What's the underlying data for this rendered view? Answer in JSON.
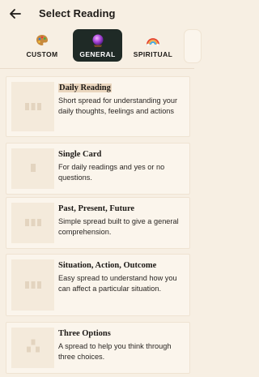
{
  "header": {
    "title": "Select Reading"
  },
  "tabs": [
    {
      "label": "CUSTOM",
      "icon": "palette-icon",
      "active": false
    },
    {
      "label": "GENERAL",
      "icon": "crystal-ball-icon",
      "active": true
    },
    {
      "label": "SPIRITUAL",
      "icon": "rainbow-icon",
      "active": false
    }
  ],
  "readings": [
    {
      "title": "Daily Reading",
      "description": "Short spread for understanding your daily thoughts, feelings and actions",
      "icon": "three-cards-icon"
    },
    {
      "title": "Single Card",
      "description": "For daily readings and yes or no questions.",
      "icon": "single-card-icon"
    },
    {
      "title": "Past, Present, Future",
      "description": "Simple spread built to give a general comprehension.",
      "icon": "three-cards-icon"
    },
    {
      "title": "Situation, Action, Outcome",
      "description": "Easy spread to understand how you can affect a particular situation.",
      "icon": "three-cards-icon"
    },
    {
      "title": "Three Options",
      "description": "A spread to help you think through three choices.",
      "icon": "pyramid-cards-icon"
    }
  ],
  "colors": {
    "background": "#f7efe3",
    "active_tab": "#1f2a26",
    "card": "#fbf5ec"
  }
}
